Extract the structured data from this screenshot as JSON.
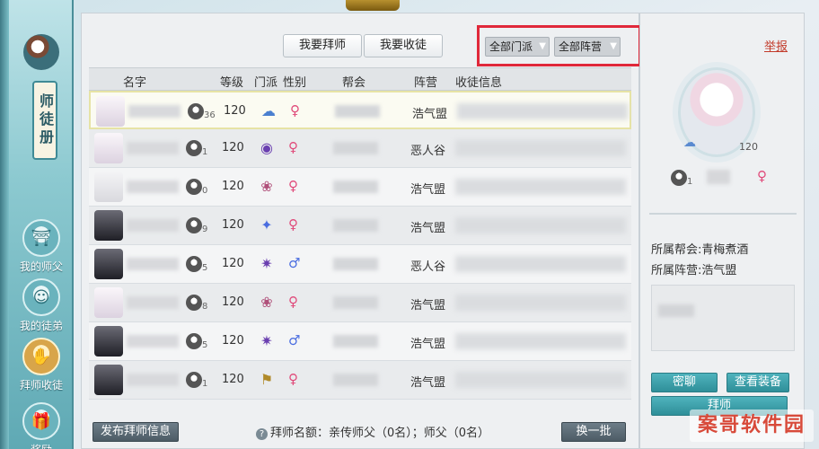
{
  "top_badges": {
    "left": "",
    "right": ""
  },
  "sidebar": {
    "book_title": "师徒册",
    "items": [
      {
        "label": "我的师父",
        "icon": "master-hat-icon",
        "active": false
      },
      {
        "label": "我的徒弟",
        "icon": "disciple-icon",
        "active": false
      },
      {
        "label": "拜师收徒",
        "icon": "bow-hands-icon",
        "active": true
      },
      {
        "label": "奖励",
        "icon": "gift-icon",
        "active": false
      }
    ]
  },
  "toolbar": {
    "seek_master_label": "我要拜师",
    "recruit_label": "我要收徒",
    "filter_school": "全部门派",
    "filter_camp": "全部阵营"
  },
  "table": {
    "headers": [
      "名字",
      "等级",
      "门派",
      "性别",
      "帮会",
      "阵营",
      "收徒信息"
    ],
    "rows": [
      {
        "mentor_count": "36",
        "level": "120",
        "school_icon": "blue-cloud-icon",
        "gender": "female",
        "gender_symbol": "♀",
        "camp": "浩气盟",
        "selected": true
      },
      {
        "mentor_count": "1",
        "level": "120",
        "school_icon": "purple-eye-icon",
        "gender": "female",
        "gender_symbol": "♀",
        "camp": "恶人谷",
        "selected": false
      },
      {
        "mentor_count": "0",
        "level": "120",
        "school_icon": "lotus-icon",
        "gender": "female",
        "gender_symbol": "♀",
        "camp": "浩气盟",
        "selected": false
      },
      {
        "mentor_count": "9",
        "level": "120",
        "school_icon": "blue-blade-icon",
        "gender": "female",
        "gender_symbol": "♀",
        "camp": "浩气盟",
        "selected": false
      },
      {
        "mentor_count": "5",
        "level": "120",
        "school_icon": "purple-flower-icon",
        "gender": "male",
        "gender_symbol": "♂",
        "camp": "恶人谷",
        "selected": false
      },
      {
        "mentor_count": "8",
        "level": "120",
        "school_icon": "lotus-icon",
        "gender": "female",
        "gender_symbol": "♀",
        "camp": "浩气盟",
        "selected": false
      },
      {
        "mentor_count": "5",
        "level": "120",
        "school_icon": "purple-flower-icon",
        "gender": "male",
        "gender_symbol": "♂",
        "camp": "浩气盟",
        "selected": false
      },
      {
        "mentor_count": "1",
        "level": "120",
        "school_icon": "golden-banner-icon",
        "gender": "female",
        "gender_symbol": "♀",
        "camp": "浩气盟",
        "selected": false
      }
    ]
  },
  "footer": {
    "post_label": "发布拜师信息",
    "quota_text": "拜师名额：亲传师父（0名）；师父（0名）",
    "refresh_label": "换一批"
  },
  "profile": {
    "report_label": "举报",
    "level": "120",
    "mentor_count": "1",
    "gender_symbol": "♀",
    "guild_line": "所属帮会:青梅煮酒",
    "camp_line": "所属阵营:浩气盟",
    "whisper_label": "密聊",
    "equipment_label": "查看装备",
    "apprentice_label": "拜师"
  },
  "watermark": "案哥软件园",
  "colors": {
    "accent_teal": "#2f8f99",
    "highlight_red": "#e0283a",
    "female": "#e04a7a",
    "male": "#4a6de0"
  }
}
